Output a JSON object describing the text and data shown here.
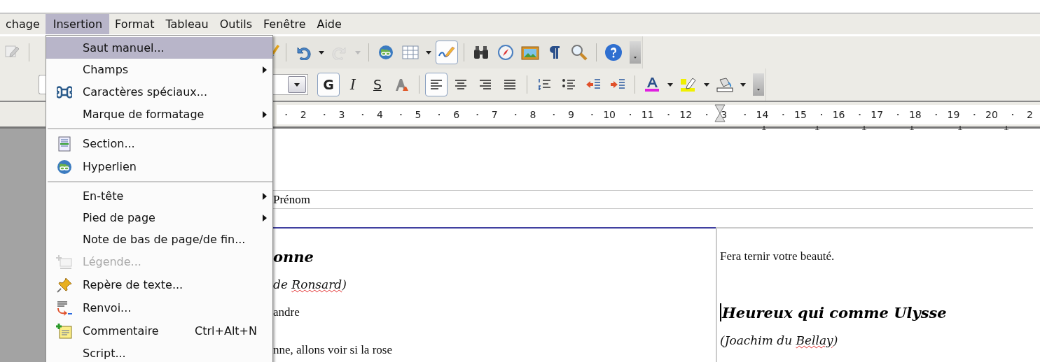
{
  "menubar": {
    "items": [
      {
        "label": "chage",
        "selected": false
      },
      {
        "label": "Insertion",
        "selected": true
      },
      {
        "label": "Format",
        "selected": false
      },
      {
        "label": "Tableau",
        "selected": false
      },
      {
        "label": "Outils",
        "selected": false
      },
      {
        "label": "Fenêtre",
        "selected": false
      },
      {
        "label": "Aide",
        "selected": false
      }
    ]
  },
  "standard_toolbar": {
    "buttons": [
      {
        "pressed": false,
        "disabled": false
      },
      {
        "pressed": false,
        "disabled": true
      },
      {
        "pressed": false,
        "disabled": false
      },
      {
        "pressed": false,
        "disabled": false
      },
      {
        "pressed": true,
        "disabled": false
      },
      {
        "pressed": false,
        "disabled": false
      },
      {
        "pressed": false,
        "disabled": false
      },
      {
        "pressed": false,
        "disabled": false
      },
      {
        "pressed": false,
        "disabled": false
      },
      {
        "pressed": false,
        "disabled": false
      },
      {
        "pressed": false,
        "disabled": false
      }
    ]
  },
  "format_toolbar": {
    "buttons": [
      {
        "label": "G",
        "pressed": true
      },
      {
        "label": "I",
        "pressed": false
      },
      {
        "label": "S",
        "pressed": false
      },
      {
        "pressed": false
      },
      {
        "pressed": true
      },
      {
        "pressed": false
      },
      {
        "pressed": false
      },
      {
        "pressed": false
      },
      {
        "pressed": false
      },
      {
        "pressed": false
      },
      {
        "pressed": false
      },
      {
        "pressed": false
      },
      {
        "pressed": false
      },
      {
        "pressed": false
      },
      {
        "pressed": false
      }
    ]
  },
  "ruler": {
    "labels": [
      "2",
      "3",
      "4",
      "5",
      "6",
      "7",
      "8",
      "9",
      "10",
      "11",
      "12",
      "3",
      "14",
      "15",
      "16",
      "17",
      "18",
      "19",
      "20",
      "2"
    ]
  },
  "insert_menu": {
    "items": [
      {
        "kind": "item",
        "label": "Saut manuel...",
        "selected": true,
        "disabled": false
      },
      {
        "kind": "submenu",
        "label": "Champs",
        "selected": false,
        "disabled": false
      },
      {
        "kind": "item",
        "label": "Caractères spéciaux...",
        "selected": false,
        "disabled": false
      },
      {
        "kind": "submenu",
        "label": "Marque de formatage",
        "selected": false,
        "disabled": false
      },
      {
        "kind": "separator"
      },
      {
        "kind": "item",
        "label": "Section...",
        "selected": false,
        "disabled": false
      },
      {
        "kind": "item",
        "label": "Hyperlien",
        "selected": false,
        "disabled": false
      },
      {
        "kind": "separator"
      },
      {
        "kind": "submenu",
        "label": "En-tête",
        "selected": false,
        "disabled": false
      },
      {
        "kind": "submenu",
        "label": "Pied de page",
        "selected": false,
        "disabled": false
      },
      {
        "kind": "item",
        "label": "Note de bas de page/de fin...",
        "selected": false,
        "disabled": false
      },
      {
        "kind": "item",
        "label": "Légende...",
        "selected": false,
        "disabled": true
      },
      {
        "kind": "item",
        "label": "Repère de texte...",
        "selected": false,
        "disabled": false
      },
      {
        "kind": "item",
        "label": "Renvoi...",
        "selected": false,
        "disabled": false
      },
      {
        "kind": "item",
        "label": "Commentaire",
        "shortcut": "Ctrl+Alt+N",
        "selected": false,
        "disabled": false
      },
      {
        "kind": "item",
        "label": "Script...",
        "selected": false,
        "disabled": false
      }
    ]
  },
  "document": {
    "header": {
      "text": "Prénom"
    },
    "left_column": [
      {
        "kind": "title",
        "parts": [
          {
            "text": "onne",
            "misspelled": false
          }
        ]
      },
      {
        "kind": "author",
        "parts": [
          {
            "text": "de ",
            "misspelled": false
          },
          {
            "text": "Ronsard",
            "misspelled": true
          },
          {
            "text": ")",
            "misspelled": false
          }
        ]
      },
      {
        "kind": "body",
        "parts": [
          {
            "text": "andre",
            "misspelled": false
          }
        ]
      },
      {
        "kind": "verse",
        "parts": [
          {
            "text": "nne, allons voir si la rose",
            "misspelled": false
          }
        ]
      }
    ],
    "right_column": [
      {
        "kind": "body",
        "parts": [
          {
            "text": "Fera ternir votre beauté.",
            "misspelled": false
          }
        ]
      },
      {
        "kind": "title",
        "cursor": true,
        "parts": [
          {
            "text": "Heureux qui comme Ulysse",
            "misspelled": false
          }
        ]
      },
      {
        "kind": "author",
        "parts": [
          {
            "text": "(Joachim du ",
            "misspelled": false
          },
          {
            "text": "Bellay",
            "misspelled": true
          },
          {
            "text": ")",
            "misspelled": false
          }
        ]
      }
    ]
  }
}
